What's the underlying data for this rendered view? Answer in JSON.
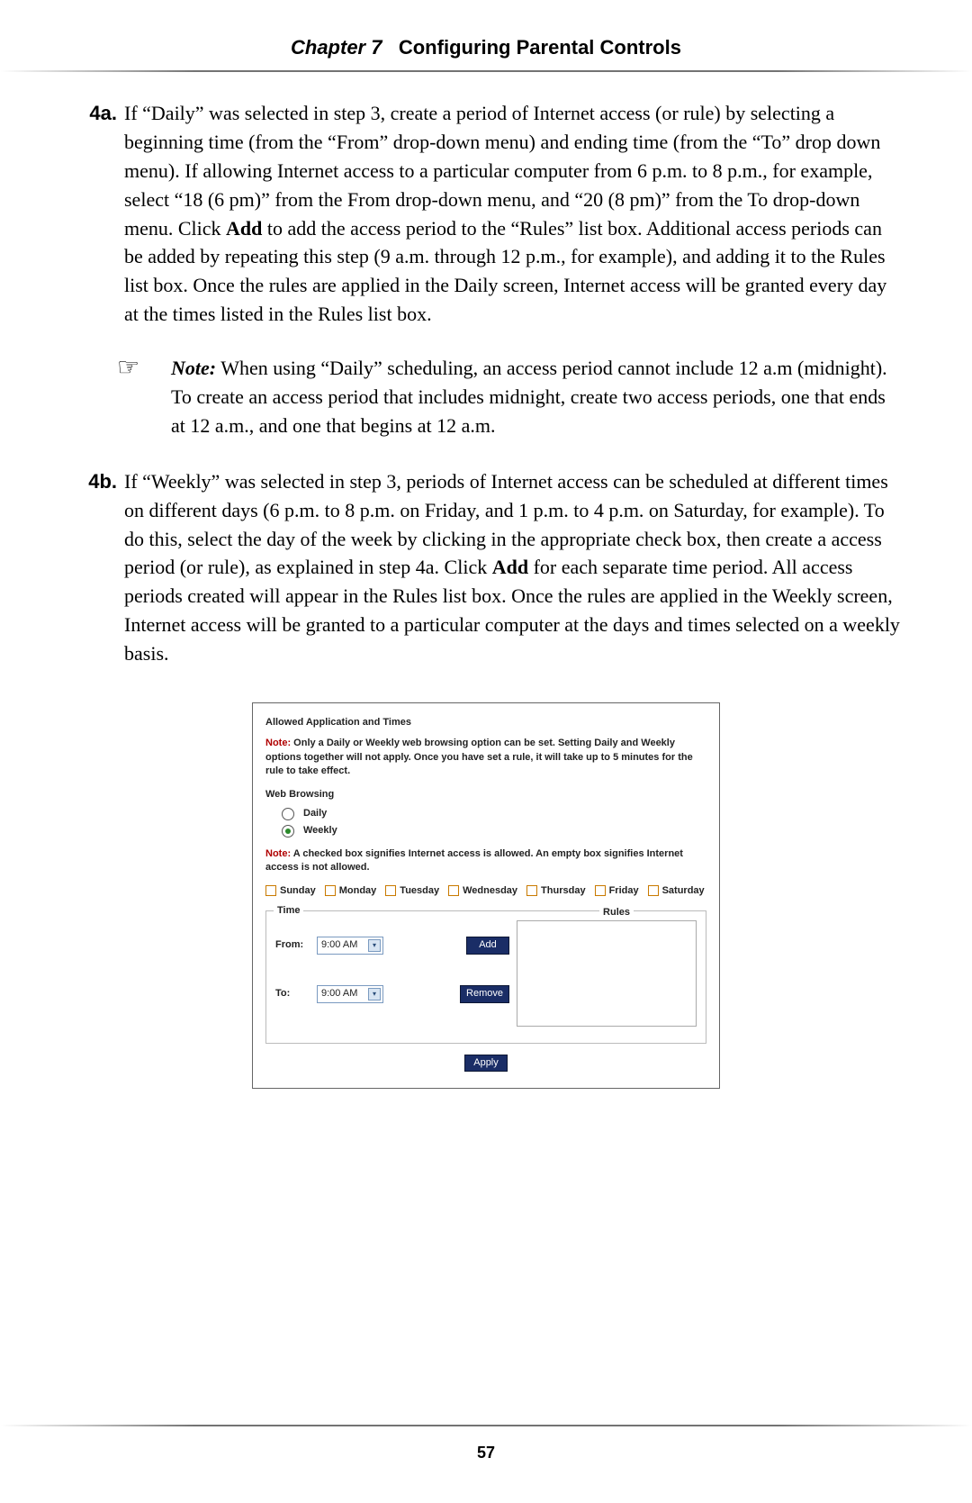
{
  "header": {
    "chapter_prefix": "Chapter 7",
    "chapter_title": "Configuring Parental Controls"
  },
  "steps": {
    "s4a": {
      "label": "4a.",
      "text_1": "If “Daily” was selected in step 3, create a period of Internet access (or rule) by selecting a beginning time (from the “From” drop-down menu) and ending time (from the “To” drop down menu). If allowing Internet access to a particular computer from 6 p.m. to 8 p.m., for example, select “18 (6 pm)” from the From drop-down menu, and “20 (8 pm)” from the To drop-down menu. Click ",
      "bold_add": "Add",
      "text_2": " to add the access period to the “Rules” list box. Additional access periods can be added by repeating this step (9 a.m. through 12 p.m., for example), and adding it to the Rules list box. Once the rules are applied in the Daily screen, Internet access will be granted every day at the times listed in the Rules list box."
    },
    "note": {
      "icon": "☞",
      "bold": "Note:",
      "text": " When using “Daily” scheduling, an access period cannot include 12 a.m (midnight). To create an access period that includes midnight, create two access periods, one that ends at 12 a.m., and one that begins at 12 a.m."
    },
    "s4b": {
      "label": "4b.",
      "text_1": "If “Weekly” was selected in step 3, periods of Internet access can be scheduled at different times on different days (6 p.m. to 8 p.m. on Friday, and 1 p.m. to 4 p.m. on Saturday, for example). To do this, select the day of the week by clicking in the appropriate check box, then create a access period (or rule), as explained in step 4a. Click ",
      "bold_add": "Add",
      "text_2": " for each separate time period. All access periods created will appear in the Rules list box. Once the rules are applied in the Weekly screen, Internet access will be granted to a particular computer at the days and times selected on a weekly basis."
    }
  },
  "panel": {
    "title": "Allowed Application and Times",
    "note1_prefix": "Note:",
    "note1_text": " Only a Daily or Weekly web browsing option can be set. Setting Daily and Weekly options together will not apply. Once you have set a rule, it will take up to 5 minutes for the rule to take effect.",
    "web_browsing": "Web Browsing",
    "radio_daily": "Daily",
    "radio_weekly": "Weekly",
    "note2_prefix": "Note:",
    "note2_text": " A checked box signifies Internet access is allowed. An empty box signifies Internet access is not allowed.",
    "days": [
      "Sunday",
      "Monday",
      "Tuesday",
      "Wednesday",
      "Thursday",
      "Friday",
      "Saturday"
    ],
    "time_legend": "Time",
    "rules_label": "Rules",
    "from_label": "From:",
    "to_label": "To:",
    "time_value": "9:00 AM",
    "btn_add": "Add",
    "btn_remove": "Remove",
    "btn_apply": "Apply"
  },
  "page_number": "57"
}
